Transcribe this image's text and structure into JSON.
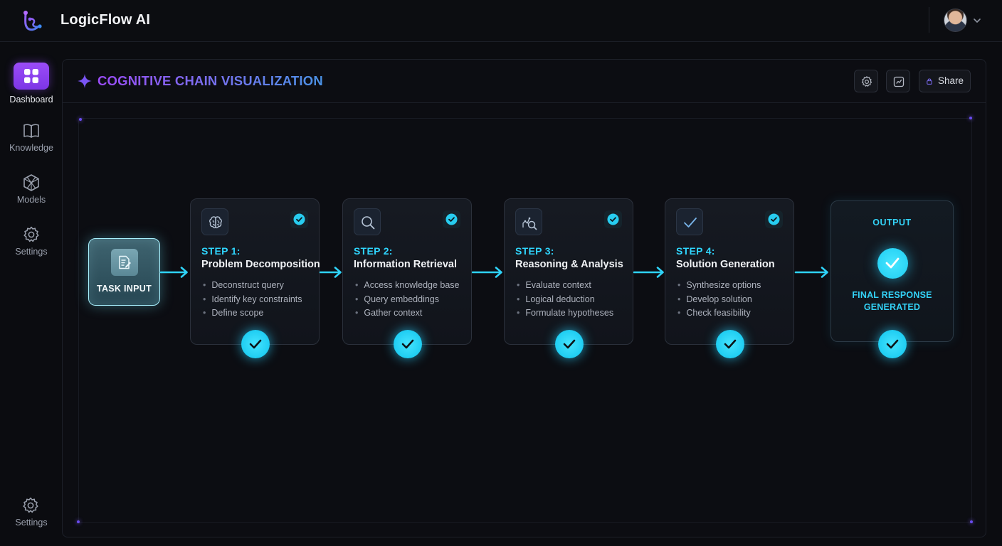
{
  "app": {
    "title": "LogicFlow AI"
  },
  "sidebar": {
    "items": [
      {
        "label": "Dashboard",
        "icon": "dashboard-grid-icon"
      },
      {
        "label": "Knowledge",
        "icon": "book-icon"
      },
      {
        "label": "Models",
        "icon": "cube-network-icon"
      },
      {
        "label": "Settings",
        "icon": "gear-icon"
      }
    ],
    "bottom": {
      "label": "Settings",
      "icon": "gear-icon"
    }
  },
  "panel": {
    "title": "COGNITIVE CHAIN VISUALIZATION",
    "share_label": "Share"
  },
  "task_input": {
    "label": "TASK INPUT"
  },
  "steps": [
    {
      "number": "STEP 1:",
      "title": "Problem Decomposition",
      "icon": "brain-icon",
      "items": [
        "Deconstruct query",
        "Identify key constraints",
        "Define scope"
      ]
    },
    {
      "number": "STEP 2:",
      "title": "Information Retrieval",
      "icon": "search-icon",
      "items": [
        "Access knowledge base",
        "Query embeddings",
        "Gather context"
      ]
    },
    {
      "number": "STEP 3:",
      "title": "Reasoning & Analysis",
      "icon": "analysis-icon",
      "items": [
        "Evaluate context",
        "Logical deduction",
        "Formulate hypotheses"
      ]
    },
    {
      "number": "STEP 4:",
      "title": "Solution Generation",
      "icon": "check-icon",
      "items": [
        "Synthesize options",
        "Develop solution",
        "Check feasibility"
      ]
    }
  ],
  "output": {
    "label": "OUTPUT",
    "line1": "FINAL RESPONSE",
    "line2": "GENERATED"
  },
  "colors": {
    "accent_purple": "#9b4cf7",
    "accent_cyan": "#2fd6ff",
    "background": "#0b0c10"
  }
}
